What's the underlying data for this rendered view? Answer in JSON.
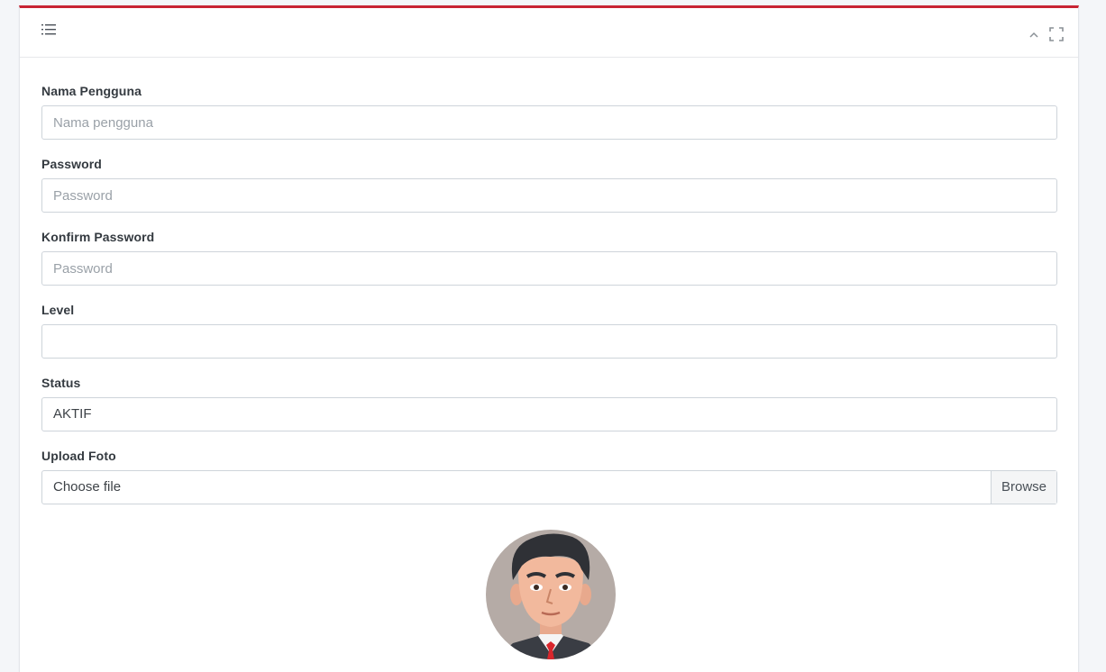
{
  "header": {
    "menu_icon": "list-icon",
    "tools": [
      {
        "name": "collapse-icon"
      },
      {
        "name": "maximize-icon"
      }
    ]
  },
  "form": {
    "username": {
      "label": "Nama Pengguna",
      "placeholder": "Nama pengguna",
      "value": ""
    },
    "password": {
      "label": "Password",
      "placeholder": "Password",
      "value": ""
    },
    "confirm_password": {
      "label": "Konfirm Password",
      "placeholder": "Password",
      "value": ""
    },
    "level": {
      "label": "Level",
      "value": ""
    },
    "status": {
      "label": "Status",
      "value": "AKTIF"
    },
    "upload": {
      "label": "Upload Foto",
      "file_text": "Choose file",
      "browse_label": "Browse"
    }
  },
  "colors": {
    "accent": "#c82333",
    "border": "#ced4da",
    "background": "#f4f6f9"
  }
}
